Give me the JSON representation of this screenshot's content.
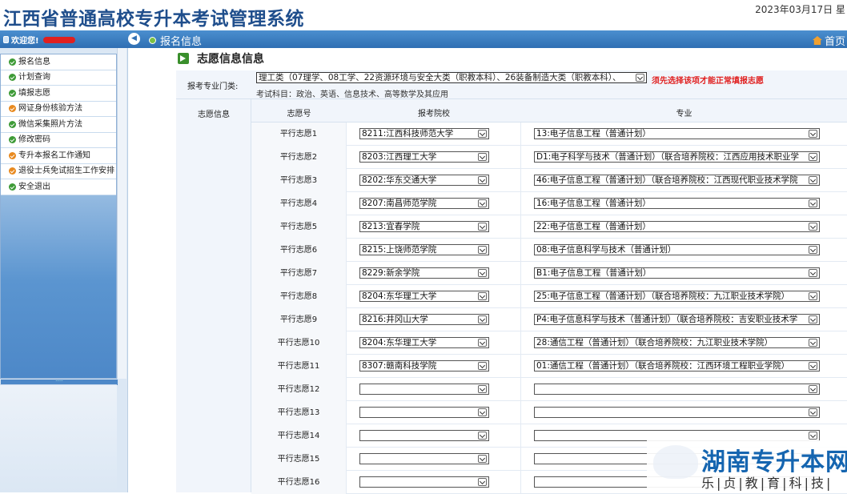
{
  "header": {
    "title": "江西省普通高校专升本考试管理系统",
    "date": "2023年03月17日 星"
  },
  "navbar": {
    "welcome": "欢迎您!",
    "breadcrumb": "报名信息",
    "home": "首页"
  },
  "sidebar": {
    "items": [
      {
        "label": "报名信息",
        "icon": "green-check-icon"
      },
      {
        "label": "计划查询",
        "icon": "green-check-icon"
      },
      {
        "label": "填报志愿",
        "icon": "green-check-icon"
      },
      {
        "label": "网证身份核验方法",
        "icon": "orange-check-icon"
      },
      {
        "label": "微信采集照片方法",
        "icon": "green-check-icon"
      },
      {
        "label": "修改密码",
        "icon": "green-check-icon"
      },
      {
        "label": "专升本报名工作通知",
        "icon": "orange-check-icon"
      },
      {
        "label": "退役士兵免试招生工作安排",
        "icon": "orange-check-icon"
      },
      {
        "label": "安全退出",
        "icon": "green-check-icon"
      }
    ]
  },
  "main": {
    "section_title": "志愿信息信息",
    "category_label": "报考专业门类:",
    "category_value": "理工类（07理学、08工学、22资源环境与安全大类（职教本科）、26装备制造大类（职教本科）、",
    "category_warning": "须先选择该项才能正常填报志愿",
    "subjects": "考试科目：政治、英语、信息技术、高等数学及其应用",
    "table_label": "志愿信息",
    "columns": {
      "num": "志愿号",
      "school": "报考院校",
      "major": "专业"
    },
    "rows": [
      {
        "num": "平行志愿1",
        "school": "8211:江西科技师范大学",
        "major": "13:电子信息工程（普通计划）"
      },
      {
        "num": "平行志愿2",
        "school": "8203:江西理工大学",
        "major": "D1:电子科学与技术（普通计划）（联合培养院校：江西应用技术职业学"
      },
      {
        "num": "平行志愿3",
        "school": "8202:华东交通大学",
        "major": "46:电子信息工程（普通计划）（联合培养院校：江西现代职业技术学院"
      },
      {
        "num": "平行志愿4",
        "school": "8207:南昌师范学院",
        "major": "16:电子信息工程（普通计划）"
      },
      {
        "num": "平行志愿5",
        "school": "8213:宜春学院",
        "major": "22:电子信息工程（普通计划）"
      },
      {
        "num": "平行志愿6",
        "school": "8215:上饶师范学院",
        "major": "08:电子信息科学与技术（普通计划）"
      },
      {
        "num": "平行志愿7",
        "school": "8229:新余学院",
        "major": "B1:电子信息工程（普通计划）"
      },
      {
        "num": "平行志愿8",
        "school": "8204:东华理工大学",
        "major": "25:电子信息工程（普通计划）（联合培养院校：九江职业技术学院）"
      },
      {
        "num": "平行志愿9",
        "school": "8216:井冈山大学",
        "major": "P4:电子信息科学与技术（普通计划）（联合培养院校：吉安职业技术学"
      },
      {
        "num": "平行志愿10",
        "school": "8204:东华理工大学",
        "major": "28:通信工程（普通计划）（联合培养院校：九江职业技术学院）"
      },
      {
        "num": "平行志愿11",
        "school": "8307:赣南科技学院",
        "major": "01:通信工程（普通计划）（联合培养院校：江西环境工程职业学院）"
      },
      {
        "num": "平行志愿12",
        "school": "",
        "major": ""
      },
      {
        "num": "平行志愿13",
        "school": "",
        "major": ""
      },
      {
        "num": "平行志愿14",
        "school": "",
        "major": ""
      },
      {
        "num": "平行志愿15",
        "school": "",
        "major": ""
      },
      {
        "num": "平行志愿16",
        "school": "",
        "major": ""
      }
    ]
  },
  "watermark": {
    "title": "湖南专升本网",
    "subtitle": "乐|贞|教|育|科|技|"
  }
}
